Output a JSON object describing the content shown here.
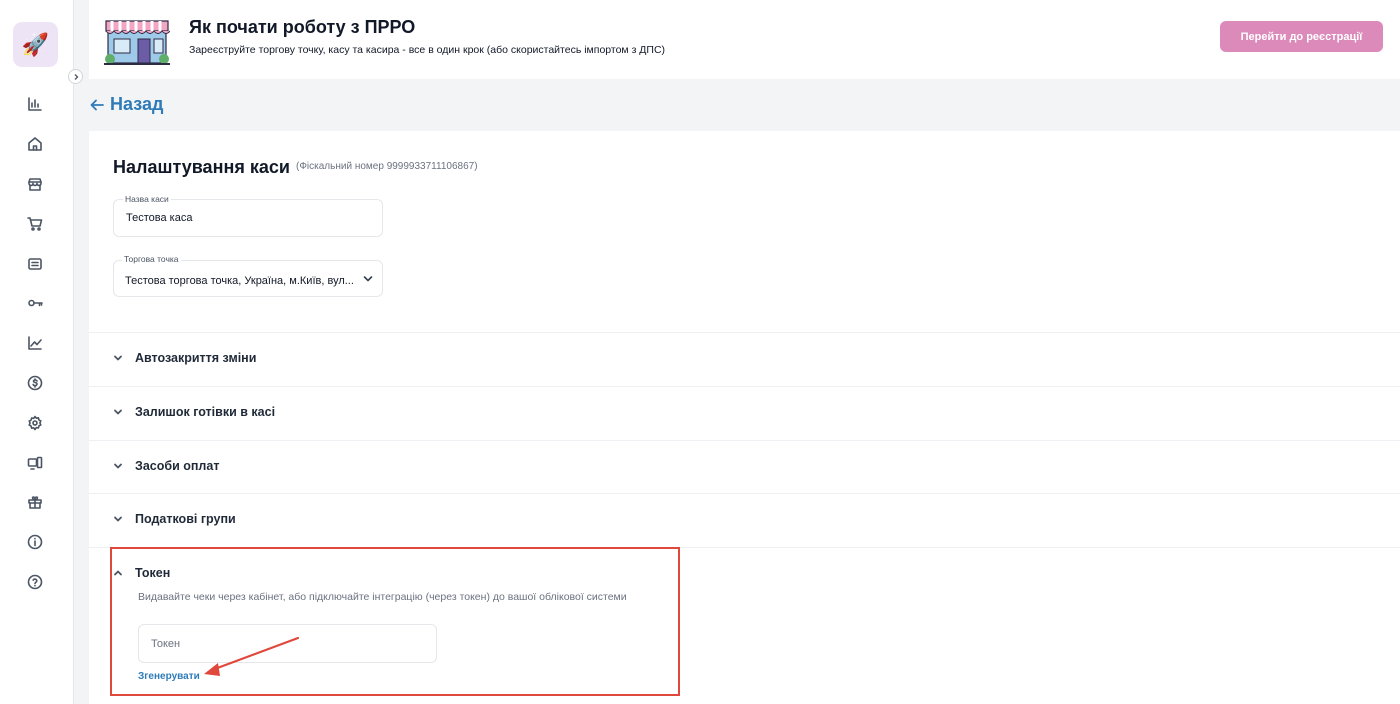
{
  "sidebar": {
    "logo": "rocket-icon",
    "collapse": "chevron-right-icon",
    "items": [
      {
        "icon": "bar-chart-icon"
      },
      {
        "icon": "home-icon"
      },
      {
        "icon": "store-icon"
      },
      {
        "icon": "cart-icon"
      },
      {
        "icon": "document-icon"
      },
      {
        "icon": "key-icon"
      },
      {
        "icon": "trend-icon"
      },
      {
        "icon": "currency-icon"
      },
      {
        "icon": "settings-icon"
      },
      {
        "icon": "devices-icon"
      },
      {
        "icon": "gift-icon"
      },
      {
        "icon": "info-icon"
      },
      {
        "icon": "help-icon"
      }
    ]
  },
  "banner": {
    "title": "Як почати роботу з ПРРО",
    "subtitle": "Зареєструйте торгову точку, касу та касира - все в один крок (або скористайтесь імпортом з ДПС)",
    "button": "Перейти до реєстрації",
    "button_color": "#dc8ab9"
  },
  "back": {
    "label": "Назад"
  },
  "page": {
    "title": "Налаштування каси",
    "fiscal": "(Фіскальний номер 9999933711106867)"
  },
  "fields": {
    "name": {
      "label": "Назва каси",
      "value": "Тестова каса"
    },
    "point": {
      "label": "Торгова точка",
      "value": "Тестова торгова точка, Україна, м.Київ, вул..."
    }
  },
  "sections": [
    {
      "label": "Автозакриття зміни"
    },
    {
      "label": "Залишок готівки в касі"
    },
    {
      "label": "Засоби оплат"
    },
    {
      "label": "Податкові групи"
    },
    {
      "label": "Токен"
    }
  ],
  "token": {
    "description": "Видавайте чеки через кабінет, або підключайте інтеграцію (через токен) до вашої облікової системи",
    "placeholder": "Токен",
    "generate": "Згенерувати"
  },
  "colors": {
    "accent": "#2e7bb8",
    "highlight": "#e0483b"
  }
}
